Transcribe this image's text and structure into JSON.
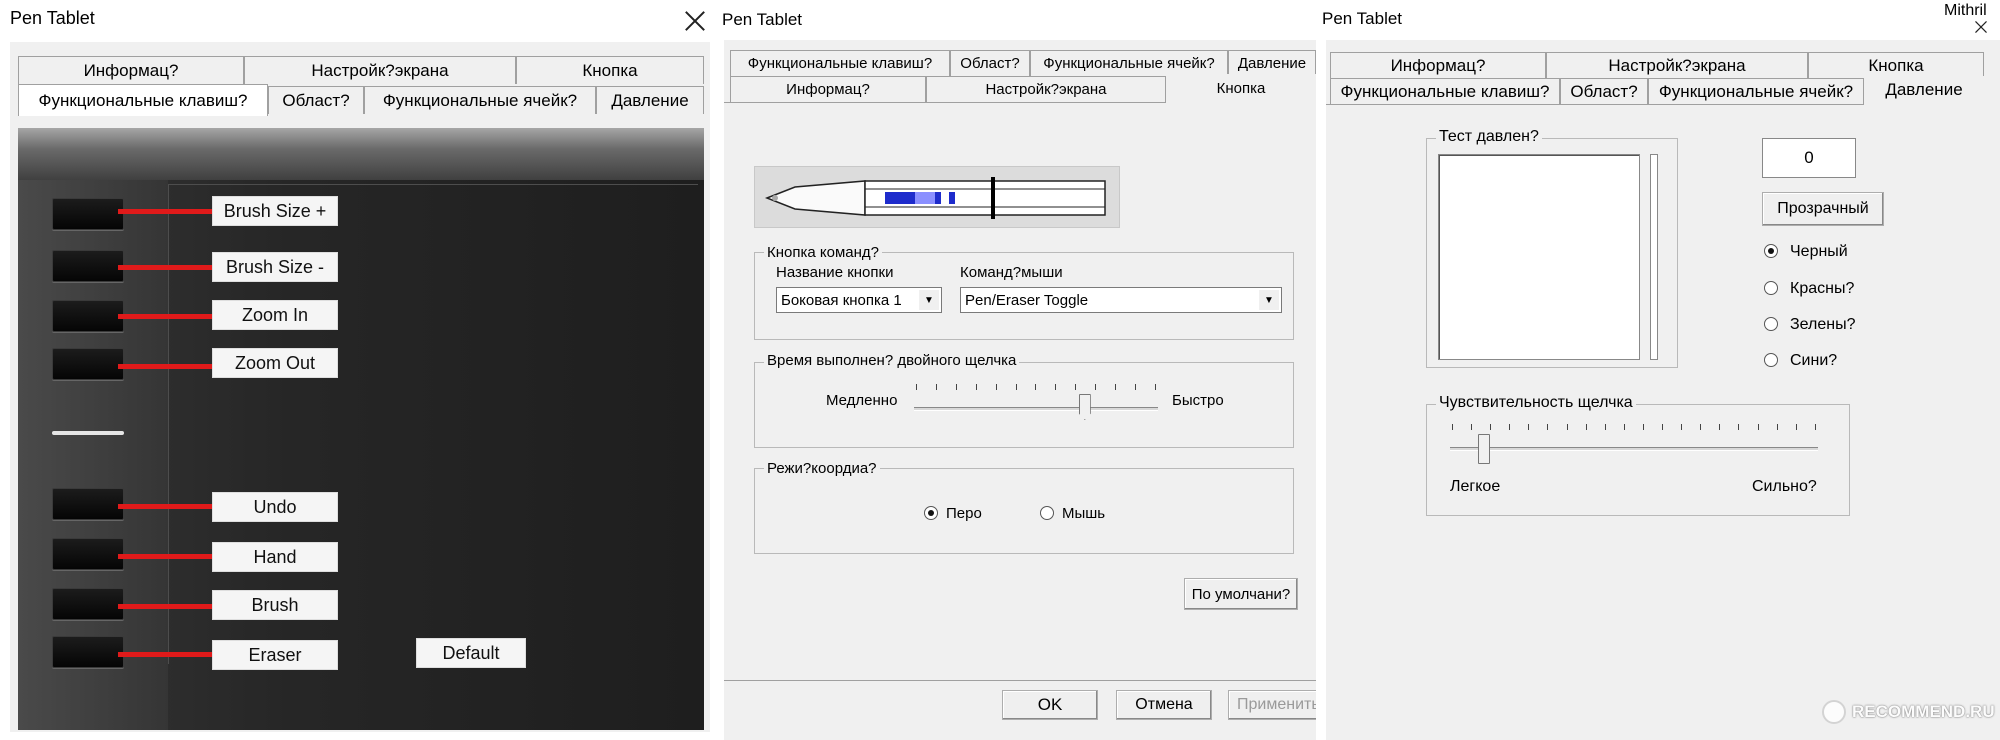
{
  "panel1": {
    "title": "Pen Tablet",
    "tabs_row1": [
      "Информац?",
      "Настройк?экрана",
      "Кнопка"
    ],
    "tabs_row2": [
      "Функциональные клавиш?",
      "Област?",
      "Функциональные ячейк?",
      "Давление"
    ],
    "express_keys": [
      "Brush Size +",
      "Brush Size -",
      "Zoom In",
      "Zoom Out",
      "Undo",
      "Hand",
      "Brush",
      "Eraser"
    ],
    "default_label": "Default"
  },
  "panel2": {
    "title": "Pen Tablet",
    "tabs_row1": [
      "Функциональные клавиш?",
      "Област?",
      "Функциональные ячейк?",
      "Давление"
    ],
    "tabs_row2": [
      "Информац?",
      "Настройк?экрана",
      "Кнопка"
    ],
    "button_cmd_group": "Кнопка команд?",
    "button_name_label": "Название кнопки",
    "mouse_cmd_label": "Команд?мыши",
    "button_name_value": "Боковая кнопка 1",
    "mouse_cmd_value": "Pen/Eraser Toggle",
    "dblclick_group": "Время выполнен? двойного щелчка",
    "slow_label": "Медленно",
    "fast_label": "Быстро",
    "dblclick_level": 0.7,
    "coord_group": "Режи?коордиа?",
    "pen_label": "Перо",
    "mouse_label": "Мышь",
    "defaults_button": "По умолчани?",
    "ok": "OK",
    "cancel": "Отмена",
    "apply": "Применить"
  },
  "panel3": {
    "title": "Pen Tablet",
    "corner_text": "Mithril",
    "tabs_row1": [
      "Информац?",
      "Настройк?экрана",
      "Кнопка"
    ],
    "tabs_row2": [
      "Функциональные клавиш?",
      "Област?",
      "Функциональные ячейк?",
      "Давление"
    ],
    "pressure_test_group": "Тест давлен?",
    "pressure_value": "0",
    "transparent_button": "Прозрачный",
    "colors": [
      "Черный",
      "Красны?",
      "Зелены?",
      "Сини?"
    ],
    "click_sens_group": "Чувствительность щелчка",
    "light_label": "Легкое",
    "strong_label": "Сильно?",
    "click_sens_level": 0.0
  },
  "watermark": "RECOMMEND.RU",
  "colors": {
    "accent_red": "#e01a1a",
    "dialog_bg": "#f0f0f0",
    "pen_blue": "#1e2ccc"
  }
}
